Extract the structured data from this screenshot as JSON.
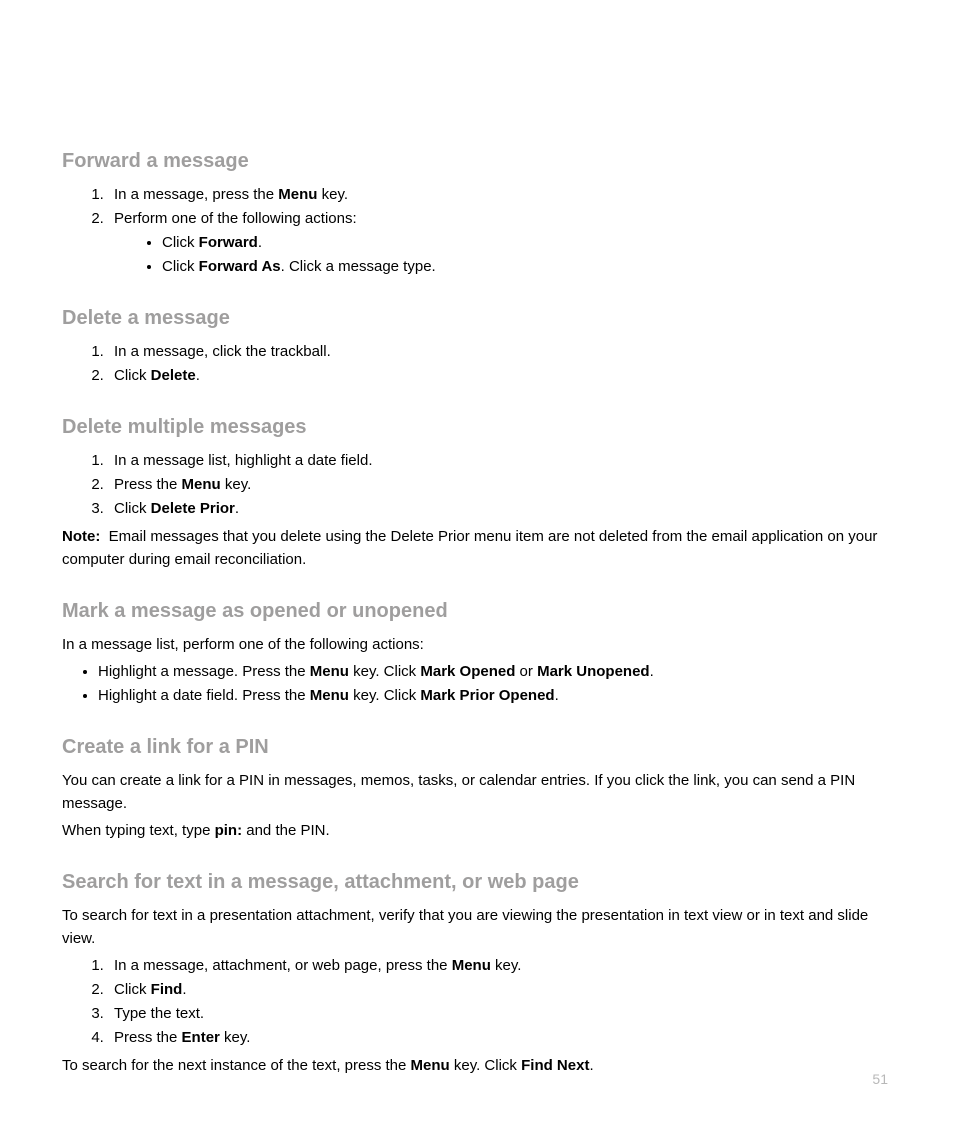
{
  "forward": {
    "heading": "Forward a message",
    "step1_pre": "In a message, press the ",
    "step1_bold": "Menu",
    "step1_post": " key.",
    "step2": "Perform one of the following actions:",
    "bullet1_pre": "Click ",
    "bullet1_bold": "Forward",
    "bullet1_post": ".",
    "bullet2_pre": "Click ",
    "bullet2_bold": "Forward As",
    "bullet2_post": ". Click a message type."
  },
  "delete": {
    "heading": "Delete a message",
    "step1": "In a message, click the trackball.",
    "step2_pre": "Click ",
    "step2_bold": "Delete",
    "step2_post": "."
  },
  "deletemulti": {
    "heading": "Delete multiple messages",
    "step1": "In a message list, highlight a date field.",
    "step2_pre": "Press the ",
    "step2_bold": "Menu",
    "step2_post": " key.",
    "step3_pre": "Click ",
    "step3_bold": "Delete Prior",
    "step3_post": ".",
    "note_label": "Note:",
    "note_text": "Email messages that you delete using the Delete Prior menu item are not deleted from the email application on your computer during email reconciliation."
  },
  "mark": {
    "heading": "Mark a message as opened or unopened",
    "intro": "In a message list, perform one of the following actions:",
    "b1_t1": "Highlight a message. Press the ",
    "b1_bold1": "Menu",
    "b1_t2": " key. Click ",
    "b1_bold2": "Mark Opened",
    "b1_t3": " or ",
    "b1_bold3": "Mark Unopened",
    "b1_t4": ".",
    "b2_t1": "Highlight a date field. Press the ",
    "b2_bold1": "Menu",
    "b2_t2": " key. Click ",
    "b2_bold2": "Mark Prior Opened",
    "b2_t3": "."
  },
  "pin": {
    "heading": "Create a link for a PIN",
    "p1": "You can create a link for a PIN in messages, memos, tasks, or calendar entries. If you click the link, you can send a PIN message.",
    "p2_pre": "When typing text, type ",
    "p2_bold": "pin:",
    "p2_post": " and the PIN."
  },
  "search": {
    "heading": "Search for text in a message, attachment, or web page",
    "intro": "To search for text in a presentation attachment, verify that you are viewing the presentation in text view or in text and slide view.",
    "s1_pre": "In a message, attachment, or web page, press the ",
    "s1_bold": "Menu",
    "s1_post": " key.",
    "s2_pre": "Click ",
    "s2_bold": "Find",
    "s2_post": ".",
    "s3": "Type the text.",
    "s4_pre": "Press the ",
    "s4_bold": "Enter",
    "s4_post": " key.",
    "out_pre": "To search for the next instance of the text, press the ",
    "out_bold1": "Menu",
    "out_mid": " key. Click ",
    "out_bold2": "Find Next",
    "out_post": "."
  },
  "pagenum": "51"
}
